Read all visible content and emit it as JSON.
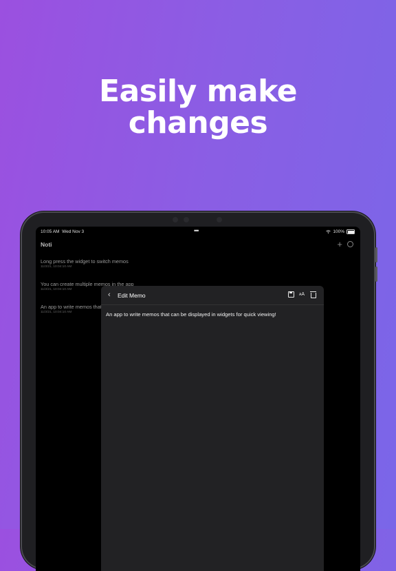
{
  "headline": {
    "line1": "Easily make",
    "line2": "changes"
  },
  "status_bar": {
    "time": "10:05 AM",
    "date": "Wed Nov 3",
    "battery": "100%"
  },
  "app": {
    "title": "Noti"
  },
  "memos": [
    {
      "text": "Long press the widget to switch memos",
      "date": "11/3/21, 10:04:10 AM"
    },
    {
      "text": "You can create multiple memos in the app",
      "date": "11/3/21, 10:04:10 AM"
    },
    {
      "text": "An app to write memos that can be displayed in widgets for quick viewing!",
      "date": "11/3/21, 10:04:10 AM"
    }
  ],
  "edit_memo": {
    "title": "Edit Memo",
    "font_size_label_big": "A",
    "font_size_label_small": "A",
    "body": "An app to write memos that can be displayed in widgets for quick viewing!"
  },
  "colors": {
    "background_start": "#9b50e0",
    "background_end": "#7a66e8",
    "screen": "#000000",
    "modal": "#222224"
  },
  "icons": [
    "back-chevron-icon",
    "save-icon",
    "font-size-icon",
    "trash-icon",
    "plus-icon",
    "settings-icon",
    "wifi-icon",
    "battery-icon"
  ]
}
